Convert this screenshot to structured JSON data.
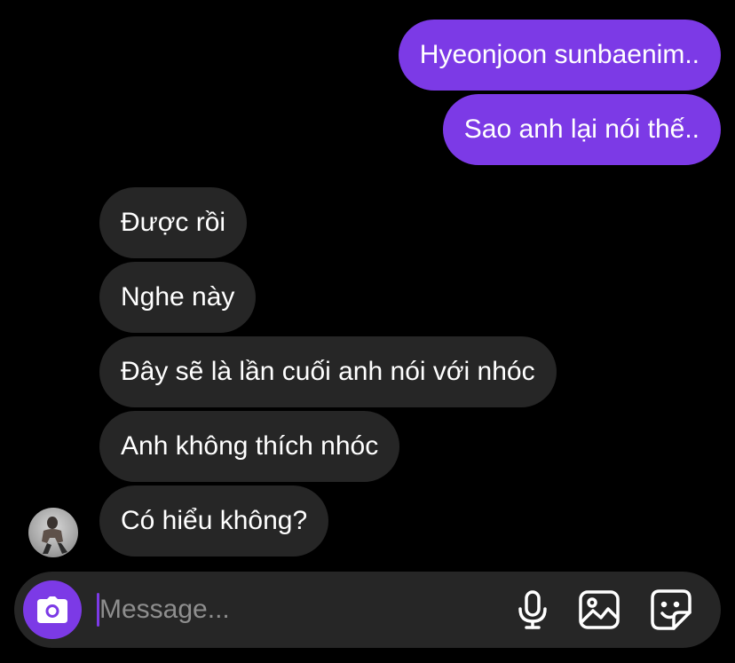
{
  "conversation": {
    "sent": [
      "Hyeonjoon sunbaenim..",
      "Sao anh lại nói thế.."
    ],
    "received": [
      "Được rồi",
      "Nghe này",
      "Đây sẽ là lần cuối anh nói với nhóc",
      "Anh không thích nhóc",
      "Có hiểu không?"
    ]
  },
  "composer": {
    "placeholder": "Message...",
    "value": "",
    "icons": [
      "camera-icon",
      "microphone-icon",
      "image-icon",
      "sticker-icon"
    ]
  },
  "colors": {
    "background": "#000000",
    "sent_bubble": "#7c3ae6",
    "received_bubble": "#262626",
    "placeholder": "#8e8e8e"
  }
}
